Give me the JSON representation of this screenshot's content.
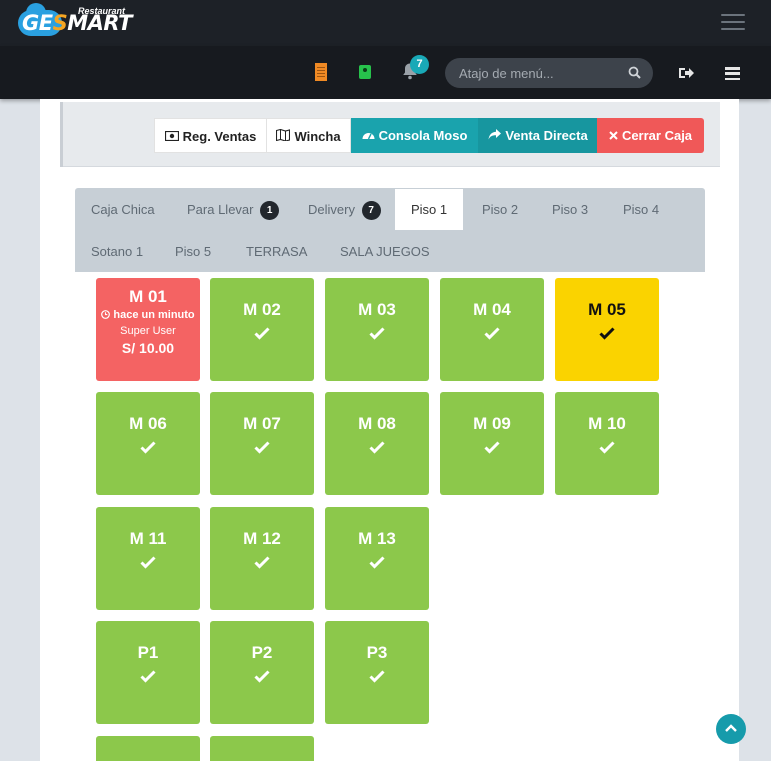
{
  "app": {
    "logo_tag": "Restaurant",
    "logo_name_part1": "GE",
    "logo_name_part2": "S",
    "logo_name_part3": "MART"
  },
  "header": {
    "notification_count": "7",
    "search_placeholder": "Atajo de menú..."
  },
  "toolbar": {
    "reg_ventas": "Reg. Ventas",
    "wincha": "Wincha",
    "consola_moso": "Consola Moso",
    "venta_directa": "Venta Directa",
    "cerrar_caja": "Cerrar Caja"
  },
  "tabs": [
    {
      "label": "Caja Chica"
    },
    {
      "label": "Para Llevar",
      "badge": "1"
    },
    {
      "label": "Delivery",
      "badge": "7"
    },
    {
      "label": "Piso 1",
      "active": true
    },
    {
      "label": "Piso 2"
    },
    {
      "label": "Piso 3"
    },
    {
      "label": "Piso 4"
    },
    {
      "label": "Sotano 1"
    },
    {
      "label": "Piso 5"
    },
    {
      "label": "TERRASA"
    },
    {
      "label": "SALA JUEGOS"
    }
  ],
  "tables": [
    {
      "name": "M 01",
      "status": "occupied",
      "time": "hace un minuto",
      "user": "Super User",
      "amount": "S/ 10.00"
    },
    {
      "name": "M 02",
      "status": "free"
    },
    {
      "name": "M 03",
      "status": "free"
    },
    {
      "name": "M 04",
      "status": "free"
    },
    {
      "name": "M 05",
      "status": "reserved"
    },
    {
      "name": "M 06",
      "status": "free"
    },
    {
      "name": "M 07",
      "status": "free"
    },
    {
      "name": "M 08",
      "status": "free"
    },
    {
      "name": "M 09",
      "status": "free"
    },
    {
      "name": "M 10",
      "status": "free"
    },
    {
      "name": "M 11",
      "status": "free"
    },
    {
      "name": "M 12",
      "status": "free"
    },
    {
      "name": "M 13",
      "status": "free"
    },
    {
      "name": "P1",
      "status": "free"
    },
    {
      "name": "P2",
      "status": "free"
    },
    {
      "name": "P3",
      "status": "free"
    },
    {
      "name": "",
      "status": "free"
    },
    {
      "name": "",
      "status": "free"
    }
  ],
  "colors": {
    "free": "#8cc84b",
    "occupied": "#f46363",
    "reserved": "#fad300",
    "accent": "#1aa3ad",
    "danger": "#f05858"
  }
}
